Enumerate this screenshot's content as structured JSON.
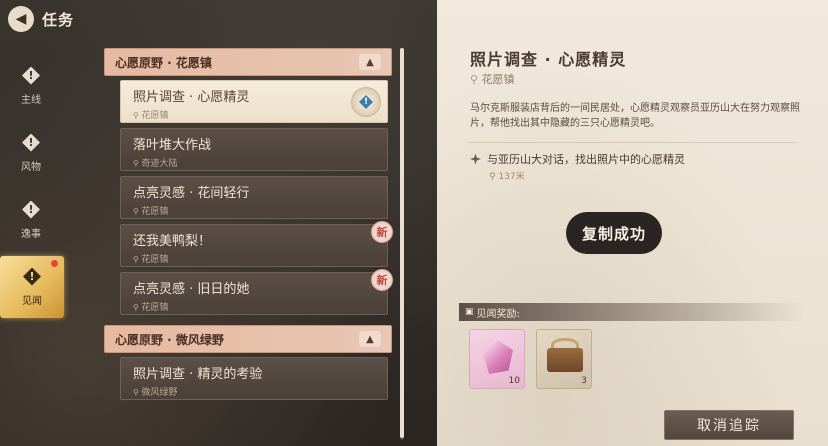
{
  "header": {
    "back_icon": "back-arrow-icon",
    "title": "任务"
  },
  "sidebar": {
    "tabs": [
      {
        "label": "主线",
        "icon": "diamond-alert-icon",
        "active": false
      },
      {
        "label": "风物",
        "icon": "diamond-alert-icon",
        "active": false
      },
      {
        "label": "逸事",
        "icon": "diamond-alert-icon",
        "active": false
      },
      {
        "label": "见闻",
        "icon": "diamond-alert-icon",
        "active": true
      }
    ]
  },
  "quest_groups": [
    {
      "name": "心愿原野 · 花愿镇",
      "quests": [
        {
          "title": "照片调查 · 心愿精灵",
          "location": "花愿镇",
          "selected": true,
          "tracked": true,
          "new": false
        },
        {
          "title": "落叶堆大作战",
          "location": "奇迹大陆",
          "selected": false,
          "new": false
        },
        {
          "title": "点亮灵感 · 花间轻行",
          "location": "花愿镇",
          "selected": false,
          "new": false
        },
        {
          "title": "还我美鸭梨！",
          "location": "花愿镇",
          "selected": false,
          "new": true
        },
        {
          "title": "点亮灵感 · 旧日的她",
          "location": "花愿镇",
          "selected": false,
          "new": true
        }
      ]
    },
    {
      "name": "心愿原野 · 微风绿野",
      "quests": [
        {
          "title": "照片调查 · 精灵的考验",
          "location": "微风绿野",
          "selected": false,
          "new": false
        }
      ]
    }
  ],
  "new_badge_label": "新",
  "detail": {
    "title": "照片调查 · 心愿精灵",
    "location": "花愿镇",
    "description": "马尔克斯服装店背后的一间民居处，心愿精灵观察员亚历山大在努力观察照片，帮他找出其中隐藏的三只心愿精灵吧。",
    "objective": "与亚历山大对话，找出照片中的心愿精灵",
    "distance": "137米",
    "toast": "复制成功",
    "reward_header": "见闻奖励:",
    "rewards": [
      {
        "icon": "pink-crystal-icon",
        "count": "10"
      },
      {
        "icon": "treasure-chest-icon",
        "count": "3"
      }
    ],
    "untrack_label": "取消追踪"
  },
  "colors": {
    "group_header": "#e6b9a0",
    "selected_item": "#f5ecdc",
    "active_tab": "#e6b85a",
    "new_badge_text": "#c0443a",
    "track_marker": "#3b7fa6"
  }
}
